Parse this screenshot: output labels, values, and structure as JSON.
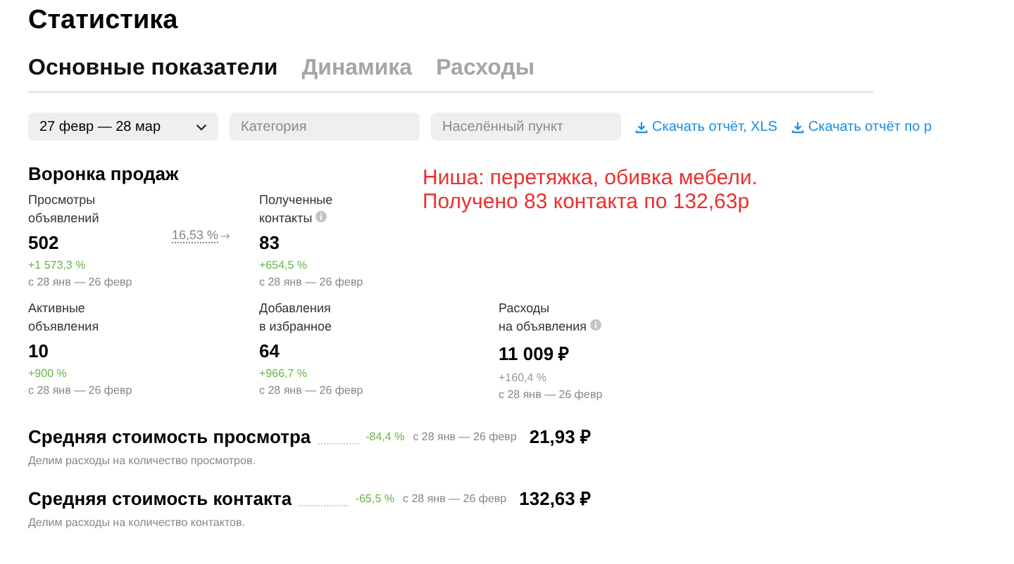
{
  "title": "Статистика",
  "tabs": [
    {
      "label": "Основные показатели",
      "selected": true
    },
    {
      "label": "Динамика",
      "selected": false
    },
    {
      "label": "Расходы",
      "selected": false
    }
  ],
  "filters": {
    "date_range": "27 февр — 28 мар",
    "category": {
      "placeholder": "Категория"
    },
    "locality": {
      "placeholder": "Населённый пункт"
    },
    "downloads": [
      "Скачать отчёт, XLS",
      "Скачать отчёт по р"
    ]
  },
  "funnel": {
    "title": "Воронка продаж",
    "conversion": "16,53 %",
    "metrics": [
      {
        "label": [
          "Просмотры",
          "объявлений"
        ],
        "info": false,
        "value": "502",
        "change": "+1 573,3 %",
        "good": true,
        "period": "с 28 янв — 26 февр"
      },
      {
        "label": [
          "Полученные",
          "контакты"
        ],
        "info": true,
        "value": "83",
        "change": "+654,5 %",
        "good": true,
        "period": "с 28 янв — 26 февр"
      },
      {
        "label": [
          "Активные",
          "объявления"
        ],
        "info": false,
        "value": "10",
        "change": "+900 %",
        "good": true,
        "period": "с 28 янв — 26 февр"
      },
      {
        "label": [
          "Добавления",
          "в избранное"
        ],
        "info": false,
        "value": "64",
        "change": "+966,7 %",
        "good": true,
        "period": "с 28 янв — 26 февр"
      },
      {
        "label": [
          "Расходы",
          "на объявления"
        ],
        "info": true,
        "value": "11 009 ₽",
        "change": "+160,4 %",
        "good": false,
        "period": "с 28 янв — 26 февр"
      }
    ]
  },
  "annotation": [
    "Ниша: перетяжка, обивка мебели.",
    "Получено 83 контакта по 132,63р"
  ],
  "costs": [
    {
      "title": "Средняя стоимость просмотра",
      "change": "-84,4 %",
      "good": true,
      "period": "с 28 янв — 26 февр",
      "value": "21,93 ₽",
      "description": "Делим расходы на количество просмотров."
    },
    {
      "title": "Средняя стоимость контакта",
      "change": "-65,5 %",
      "good": true,
      "period": "с 28 янв — 26 февр",
      "value": "132,63 ₽",
      "description": "Делим расходы на количество контактов."
    }
  ]
}
